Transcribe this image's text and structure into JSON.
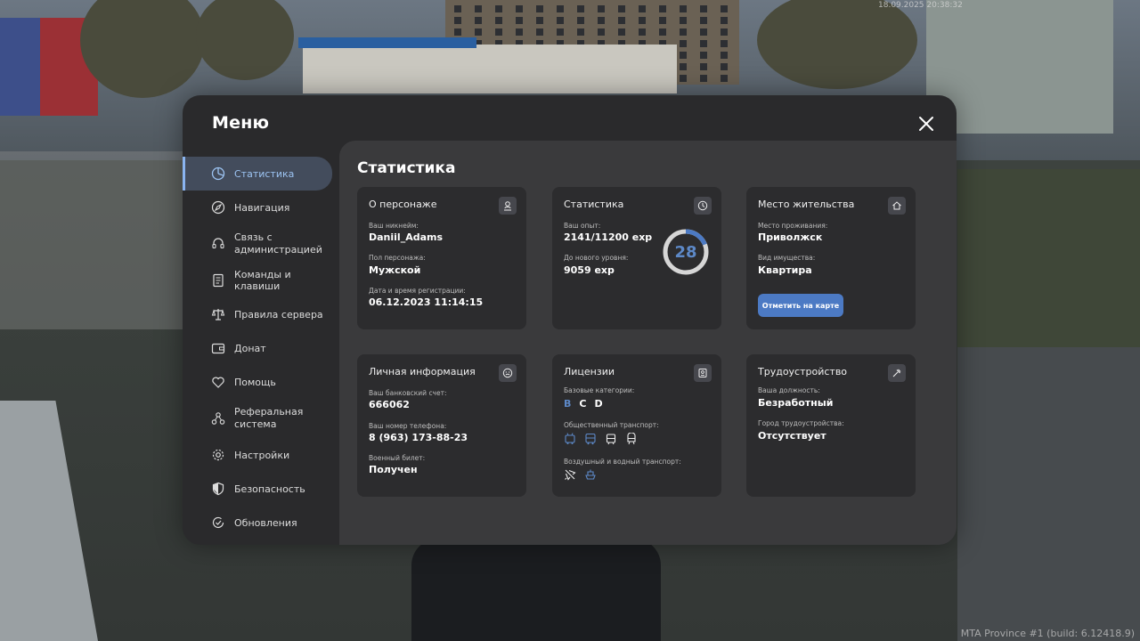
{
  "background": {
    "timestamp": "18.09.2025 20:38:32",
    "build_info": "MTA Province #1 (build: 6.12418.9)"
  },
  "menu": {
    "title": "Меню",
    "close_icon": "close-icon"
  },
  "sidebar": {
    "items": [
      {
        "label": "Статистика",
        "icon": "pie-chart-icon",
        "active": true
      },
      {
        "label": "Навигация",
        "icon": "compass-icon",
        "active": false
      },
      {
        "label": "Связь с администрацией",
        "icon": "headset-icon",
        "active": false
      },
      {
        "label": "Команды и клавиши",
        "icon": "document-icon",
        "active": false
      },
      {
        "label": "Правила сервера",
        "icon": "scales-icon",
        "active": false
      },
      {
        "label": "Донат",
        "icon": "wallet-icon",
        "active": false
      },
      {
        "label": "Помощь",
        "icon": "heart-hand-icon",
        "active": false
      },
      {
        "label": "Реферальная система",
        "icon": "referral-icon",
        "active": false
      },
      {
        "label": "Настройки",
        "icon": "gear-icon",
        "active": false
      },
      {
        "label": "Безопасность",
        "icon": "shield-icon",
        "active": false
      },
      {
        "label": "Обновления",
        "icon": "refresh-check-icon",
        "active": false
      }
    ]
  },
  "content": {
    "title": "Статистика",
    "character": {
      "title": "О персонаже",
      "icon": "person-icon",
      "nickname_label": "Ваш никнейм:",
      "nickname": "Daniil_Adams",
      "gender_label": "Пол персонажа:",
      "gender": "Мужской",
      "reg_label": "Дата и время регистрации:",
      "reg_date": "06.12.2023 11:14:15"
    },
    "stats": {
      "title": "Статистика",
      "icon": "clock-icon",
      "exp_label": "Ваш опыт:",
      "exp": "2141/11200 exp",
      "next_label": "До нового уровня:",
      "next": "9059 exp",
      "level": "28",
      "level_progress": 0.19
    },
    "residence": {
      "title": "Место жительства",
      "icon": "home-icon",
      "place_label": "Место проживания:",
      "place": "Приволжск",
      "property_label": "Вид имущества:",
      "property": "Квартира",
      "map_button": "Отметить на карте"
    },
    "personal": {
      "title": "Личная информация",
      "icon": "face-icon",
      "bank_label": "Ваш банковский счет:",
      "bank": "666062",
      "phone_label": "Ваш номер телефона:",
      "phone": "8 (963) 173-88-23",
      "military_label": "Военный билет:",
      "military": "Получен"
    },
    "licenses": {
      "title": "Лицензии",
      "icon": "id-card-icon",
      "base_label": "Базовые категории:",
      "categories": [
        {
          "name": "B",
          "owned": true
        },
        {
          "name": "C",
          "owned": false
        },
        {
          "name": "D",
          "owned": false
        }
      ],
      "public_label": "Общественный транспорт:",
      "public_icons": [
        "trolleybus-icon",
        "bus-icon",
        "tram-icon",
        "train-icon"
      ],
      "air_label": "Воздушный и водный транспорт:",
      "air_icons": [
        "airplane-icon",
        "boat-icon"
      ]
    },
    "employment": {
      "title": "Трудоустройство",
      "icon": "tools-icon",
      "position_label": "Ваша должность:",
      "position": "Безработный",
      "city_label": "Город трудоустройства:",
      "city": "Отсутствует"
    }
  },
  "colors": {
    "accent": "#5d89c8",
    "button": "#4c7ac4",
    "active_nav": "#434c5c"
  }
}
